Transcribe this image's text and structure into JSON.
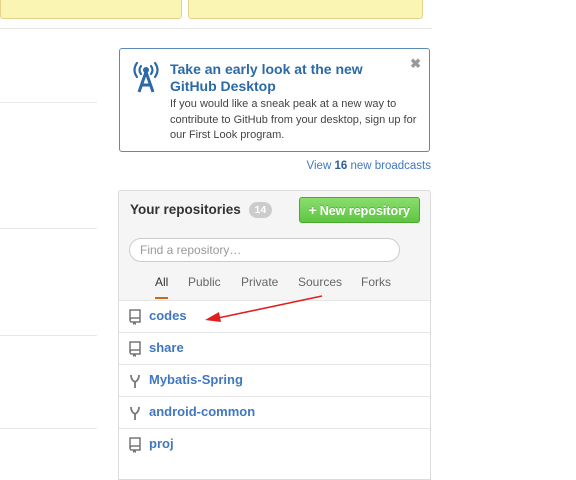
{
  "broadcast": {
    "title": "Take an early look at the new GitHub Desktop",
    "text": "If you would like a sneak peak at a new way to contribute to GitHub from your desktop, sign up for our First Look program.",
    "close_glyph": "✖",
    "view_prefix": "View ",
    "view_count": "16",
    "view_suffix": " new broadcasts"
  },
  "repos": {
    "title": "Your repositories",
    "count": "14",
    "new_button_plus": "+",
    "new_button_label": "New repository",
    "search_placeholder": "Find a repository…",
    "filters": [
      "All",
      "Public",
      "Private",
      "Sources",
      "Forks"
    ],
    "active_filter": "All",
    "items": [
      {
        "name": "codes",
        "icon": "repo-icon"
      },
      {
        "name": "share",
        "icon": "repo-icon"
      },
      {
        "name": "Mybatis-Spring",
        "icon": "fork-icon"
      },
      {
        "name": "android-common",
        "icon": "fork-icon"
      },
      {
        "name": "proj",
        "icon": "repo-icon"
      }
    ]
  },
  "colors": {
    "accent_link": "#4078c0",
    "broadcast_border": "#5b89b8",
    "new_button_green": "#5ec642",
    "active_tab_underline": "#d26911",
    "annotation_arrow": "#e02020"
  }
}
